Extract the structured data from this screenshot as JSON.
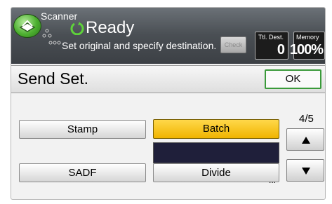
{
  "header": {
    "app_name": "Scanner",
    "status": "Ready",
    "message": "Set original and specify destination.",
    "check_label": "Check",
    "ttl_dest_label": "Ttl. Dest.",
    "ttl_dest_value": "0",
    "memory_label": "Memory",
    "memory_value": "100%"
  },
  "title_bar": {
    "title": "Send Set.",
    "ok_label": "OK"
  },
  "options": {
    "stamp": "Stamp",
    "batch": "Batch",
    "sadf": "SADF",
    "divide": "Divide",
    "divide_more": "..."
  },
  "pager": {
    "indicator": "4/5"
  },
  "colors": {
    "accent_selected": "#f5c400",
    "ok_border": "#3a9a3a",
    "header_bg": "#4a4f54"
  },
  "icons": {
    "app": "scanner-icon",
    "status": "ready-icon",
    "page_up": "up-arrow-icon",
    "page_down": "down-arrow-icon"
  }
}
